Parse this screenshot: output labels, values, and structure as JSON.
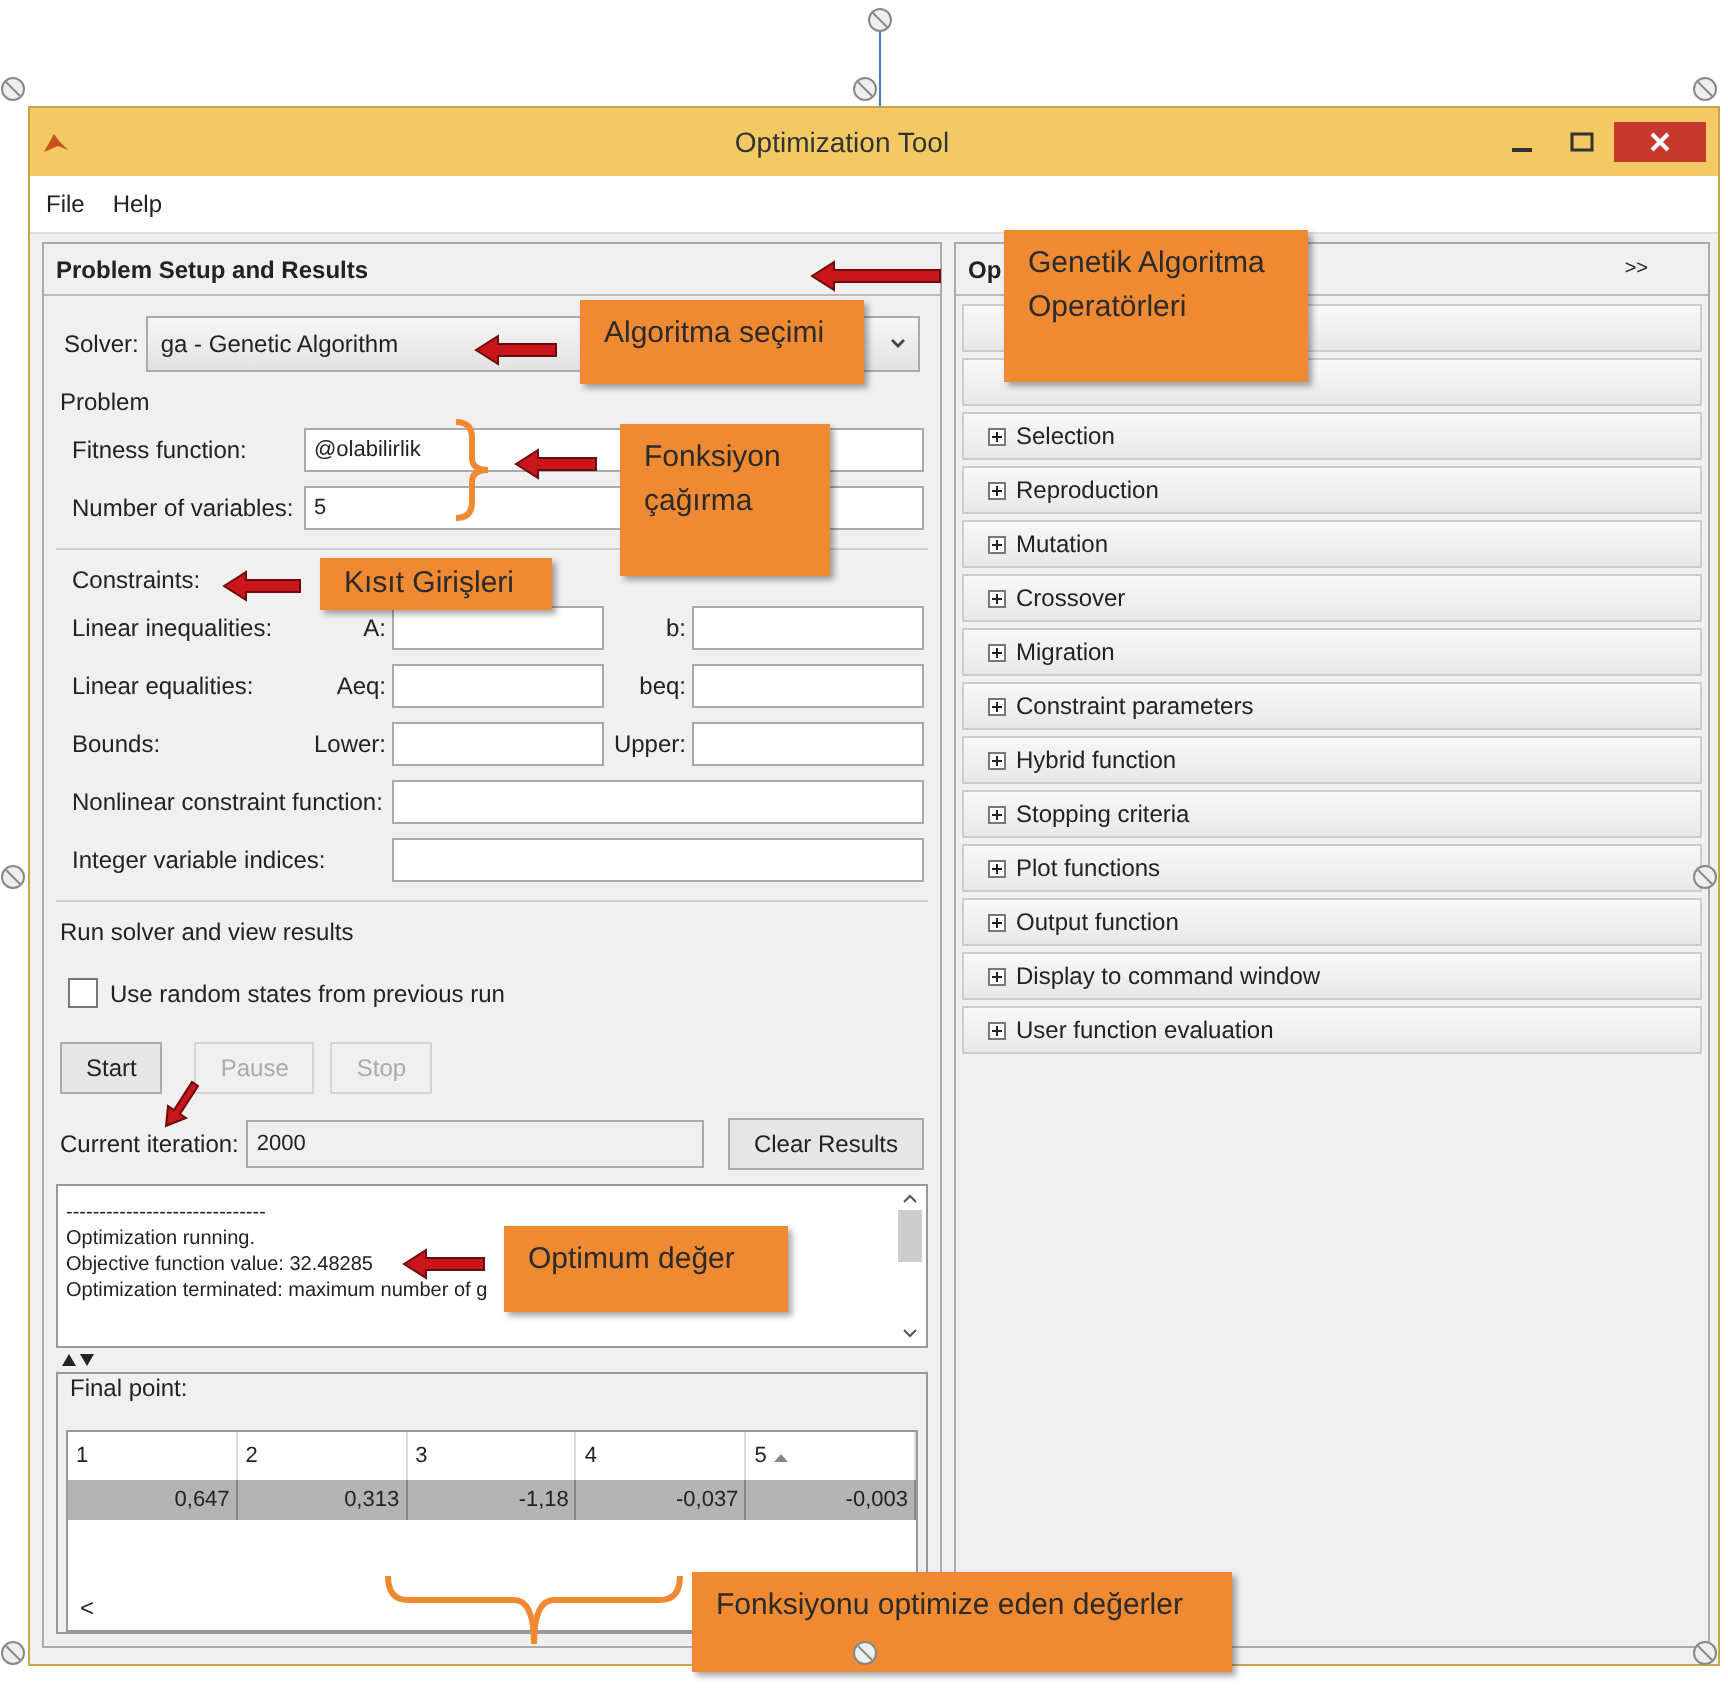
{
  "window": {
    "title": "Optimization Tool"
  },
  "menu": [
    "File",
    "Help"
  ],
  "setup": {
    "header": "Problem Setup and Results",
    "solver": {
      "label": "Solver:",
      "value": "ga - Genetic Algorithm"
    },
    "problem_label": "Problem",
    "fields": [
      {
        "label": "Fitness function:",
        "value": "@olabilirlik"
      },
      {
        "label": "Number of variables:",
        "value": "5"
      }
    ],
    "constraints_label": "Constraints:",
    "constraints": [
      {
        "kind": "pair",
        "label": "Linear inequalities:",
        "first": "A:",
        "second": "b:"
      },
      {
        "kind": "pair",
        "label": "Linear equalities:",
        "first": "Aeq:",
        "second": "beq:"
      },
      {
        "kind": "pair",
        "label": "Bounds:",
        "first": "Lower:",
        "second": "Upper:"
      },
      {
        "kind": "single",
        "label": "Nonlinear constraint function:"
      },
      {
        "kind": "single",
        "label": "Integer variable indices:"
      }
    ],
    "run_label": "Run solver and view results",
    "checkbox": {
      "label": "Use random states from previous run",
      "checked": false
    },
    "buttons": [
      {
        "label": "Start",
        "disabled": false
      },
      {
        "label": "Pause",
        "disabled": true
      },
      {
        "label": "Stop",
        "disabled": true
      }
    ],
    "iteration": {
      "label": "Current iteration:",
      "value": "2000"
    },
    "clear_button": "Clear Results",
    "output_lines": [
      "------------------------------",
      "Optimization running.",
      "Objective function value: 32.48285",
      "Optimization terminated: maximum number of g"
    ],
    "final_point": {
      "label": "Final point:",
      "columns": [
        "1",
        "2",
        "3",
        "4",
        "5"
      ],
      "rows": [
        {
          "cells": [
            "0,647",
            "0,313",
            "-1,18",
            "-0,037",
            "-0,003"
          ],
          "selected": true
        }
      ],
      "scroll": "<"
    }
  },
  "options": {
    "header": "Op",
    "collapse": ">>",
    "items": [
      {
        "kind": "blank"
      },
      {
        "kind": "blank"
      },
      {
        "label": "Selection",
        "expanded": false
      },
      {
        "label": "Reproduction",
        "expanded": false
      },
      {
        "label": "Mutation",
        "expanded": false
      },
      {
        "label": "Crossover",
        "expanded": false
      },
      {
        "label": "Migration",
        "expanded": false
      },
      {
        "label": "Constraint parameters",
        "expanded": false
      },
      {
        "label": "Hybrid function",
        "expanded": false
      },
      {
        "label": "Stopping criteria",
        "expanded": false
      },
      {
        "label": "Plot functions",
        "expanded": false
      },
      {
        "label": "Output function",
        "expanded": false
      },
      {
        "label": "Display to command window",
        "expanded": false
      },
      {
        "label": "User function evaluation",
        "expanded": false
      }
    ]
  },
  "annotations": [
    {
      "kind": "callout",
      "text": "Genetik Algoritma Operatörleri"
    },
    {
      "kind": "arrow"
    },
    {
      "kind": "callout",
      "text": "Algoritma seçimi"
    },
    {
      "kind": "arrow"
    },
    {
      "kind": "callout",
      "text": "Fonksiyon çağırma"
    },
    {
      "kind": "brace"
    },
    {
      "kind": "arrow"
    },
    {
      "kind": "callout",
      "text": "Kısıt Girişleri"
    },
    {
      "kind": "arrow"
    },
    {
      "kind": "diagonal_arrow"
    },
    {
      "kind": "callout",
      "text": "Optimum değer"
    },
    {
      "kind": "arrow"
    },
    {
      "kind": "brace_down"
    },
    {
      "kind": "callout",
      "text": "Fonksiyonu optimize eden değerler"
    }
  ]
}
